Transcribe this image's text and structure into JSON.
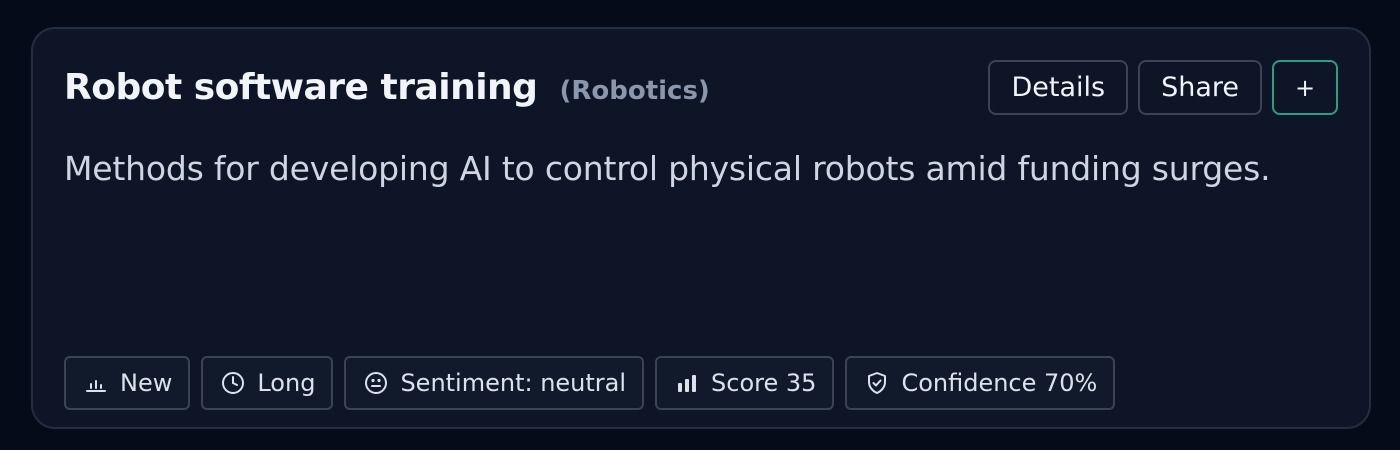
{
  "card": {
    "title": "Robot software training",
    "category": "(Robotics)",
    "description": "Methods for developing AI to control physical robots amid funding surges."
  },
  "actions": {
    "details_label": "Details",
    "share_label": "Share",
    "add_label": "+"
  },
  "tags": [
    {
      "icon": "bar-chart-low-icon",
      "label": "New"
    },
    {
      "icon": "clock-icon",
      "label": "Long"
    },
    {
      "icon": "neutral-face-icon",
      "label": "Sentiment: neutral"
    },
    {
      "icon": "bar-chart-high-icon",
      "label": "Score 35"
    },
    {
      "icon": "shield-check-icon",
      "label": "Confidence 70%"
    }
  ],
  "colors": {
    "page_background": "#060b19",
    "card_background": "#0d1526",
    "accent_border": "#2c9d80"
  }
}
